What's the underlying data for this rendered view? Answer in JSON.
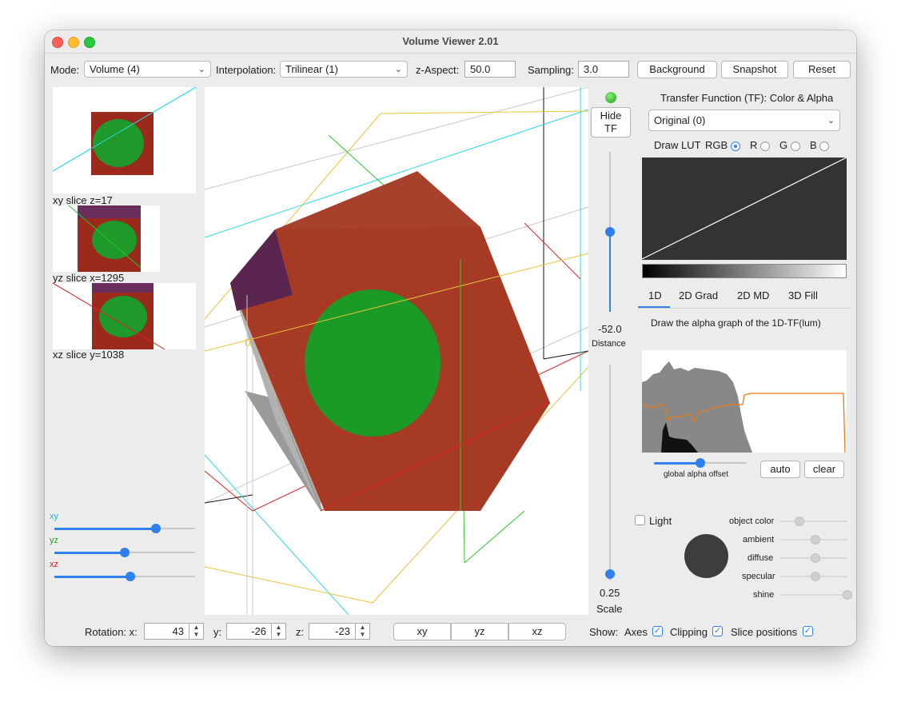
{
  "window": {
    "title": "Volume Viewer 2.01"
  },
  "toolbar": {
    "mode_label": "Mode:",
    "mode_value": "Volume (4)",
    "interp_label": "Interpolation:",
    "interp_value": "Trilinear (1)",
    "zaspect_label": "z-Aspect:",
    "zaspect_value": "50.0",
    "sampling_label": "Sampling:",
    "sampling_value": "3.0",
    "background_label": "Background",
    "snapshot_label": "Snapshot",
    "reset_label": "Reset"
  },
  "slices": {
    "xy_label": "xy slice  z=17",
    "yz_label": "yz slice  x=1295",
    "xz_label": "xz slice  y=1038",
    "xy_slider": "xy",
    "yz_slider": "yz",
    "xz_slider": "xz",
    "xy_pos": 0.74,
    "yz_pos": 0.5,
    "xz_pos": 0.54
  },
  "viewport": {
    "axis_marker": "0"
  },
  "controls": {
    "hide_tf": "Hide\nTF",
    "distance_value": "-52.0",
    "distance_label": "Distance",
    "scale_value": "0.25",
    "scale_label": "Scale"
  },
  "tf": {
    "title": "Transfer Function (TF): Color & Alpha",
    "lut_value": "Original (0)",
    "draw_lut": "Draw LUT",
    "rgb": "RGB",
    "r": "R",
    "g": "G",
    "b": "B",
    "tabs": [
      "1D",
      "2D Grad",
      "2D MD",
      "3D Fill"
    ],
    "description": "Draw the alpha graph of the 1D-TF(lum)",
    "alpha_offset_label": "global alpha offset",
    "auto_label": "auto",
    "clear_label": "clear",
    "light_label": "Light",
    "object_color": "object color",
    "ambient": "ambient",
    "diffuse": "diffuse",
    "specular": "specular",
    "shine": "shine"
  },
  "bottom": {
    "rotation_label": "Rotation: x:",
    "rot_x": "43",
    "y_label": "y:",
    "rot_y": "-26",
    "z_label": "z:",
    "rot_z": "-23",
    "view_xy": "xy",
    "view_yz": "yz",
    "view_xz": "xz",
    "show_label": "Show:",
    "axes_label": "Axes",
    "clipping_label": "Clipping",
    "slice_positions_label": "Slice positions"
  }
}
